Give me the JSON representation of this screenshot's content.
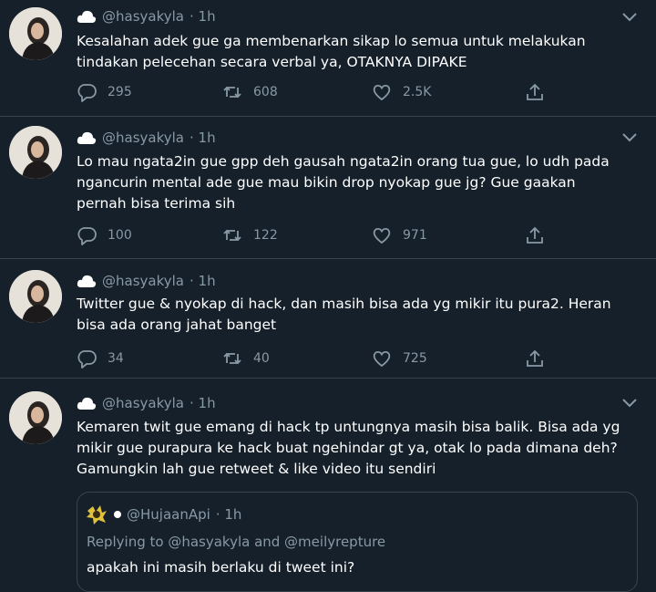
{
  "colors": {
    "background": "#15202b",
    "divider": "#38444d",
    "muted_text": "#8899a6",
    "primary_text": "#ffffff"
  },
  "icons": {
    "caret": "chevron-down-icon",
    "reply": "reply-icon",
    "retweet": "retweet-icon",
    "like": "heart-icon",
    "share": "share-icon",
    "cloud": "cloud-icon"
  },
  "tweets": [
    {
      "handle": "@hasyakyla",
      "time": "· 1h",
      "lines": [
        "Kesalahan adek gue ga membenarkan sikap lo semua untuk melakukan",
        "tindakan pelecehan secara verbal ya, OTAKNYA DIPAKE"
      ],
      "replies": "295",
      "retweets": "608",
      "likes": "2.5K"
    },
    {
      "handle": "@hasyakyla",
      "time": "· 1h",
      "lines": [
        "Lo mau ngata2in gue gpp deh gausah ngata2in orang tua gue, lo udh pada",
        "ngancurin mental ade gue mau bikin drop nyokap gue jg? Gue gaakan",
        "pernah bisa terima sih"
      ],
      "replies": "100",
      "retweets": "122",
      "likes": "971"
    },
    {
      "handle": "@hasyakyla",
      "time": "· 1h",
      "lines": [
        "Twitter gue & nyokap di hack, dan masih bisa ada yg mikir itu pura2. Heran",
        "bisa ada orang jahat banget"
      ],
      "replies": "34",
      "retweets": "40",
      "likes": "725"
    },
    {
      "handle": "@hasyakyla",
      "time": "· 1h",
      "lines": [
        "Kemaren twit gue emang di hack tp untungnya masih bisa balik. Bisa ada yg",
        "mikir gue purapura ke hack buat ngehindar gt ya, otak lo pada dimana deh?",
        "Gamungkin lah gue retweet & like video itu sendiri"
      ]
    }
  ],
  "quoted": {
    "handle": "@HujaanApi",
    "time": "· 1h",
    "replying_to": "Replying to @hasyakyla and @meilyrepture",
    "text": "apakah ini masih berlaku di tweet ini?"
  }
}
